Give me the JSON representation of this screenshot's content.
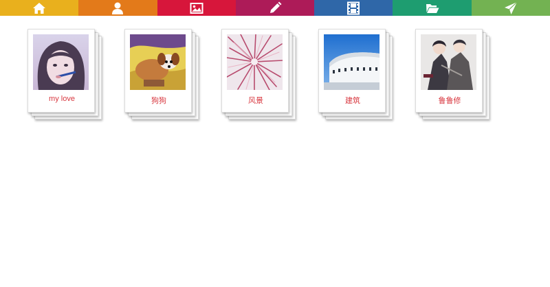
{
  "nav": {
    "items": [
      {
        "icon": "home-icon",
        "color": "#e9b01d"
      },
      {
        "icon": "user-icon",
        "color": "#e37a1a"
      },
      {
        "icon": "picture-icon",
        "color": "#d7163b"
      },
      {
        "icon": "pencil-icon",
        "color": "#ad1b58"
      },
      {
        "icon": "film-icon",
        "color": "#2f67a8"
      },
      {
        "icon": "folder-open-icon",
        "color": "#1e9d70"
      },
      {
        "icon": "send-icon",
        "color": "#73b252"
      }
    ]
  },
  "albums": [
    {
      "title": "my love",
      "photo": "girl-portrait-photo"
    },
    {
      "title": "狗狗",
      "photo": "dog-photo"
    },
    {
      "title": "风景",
      "photo": "flower-macro-photo"
    },
    {
      "title": "建筑",
      "photo": "white-building-photo"
    },
    {
      "title": "鲁鲁修",
      "photo": "anime-characters-photo"
    }
  ],
  "colors": {
    "caption": "#d8373f",
    "background": "#ffffff"
  }
}
